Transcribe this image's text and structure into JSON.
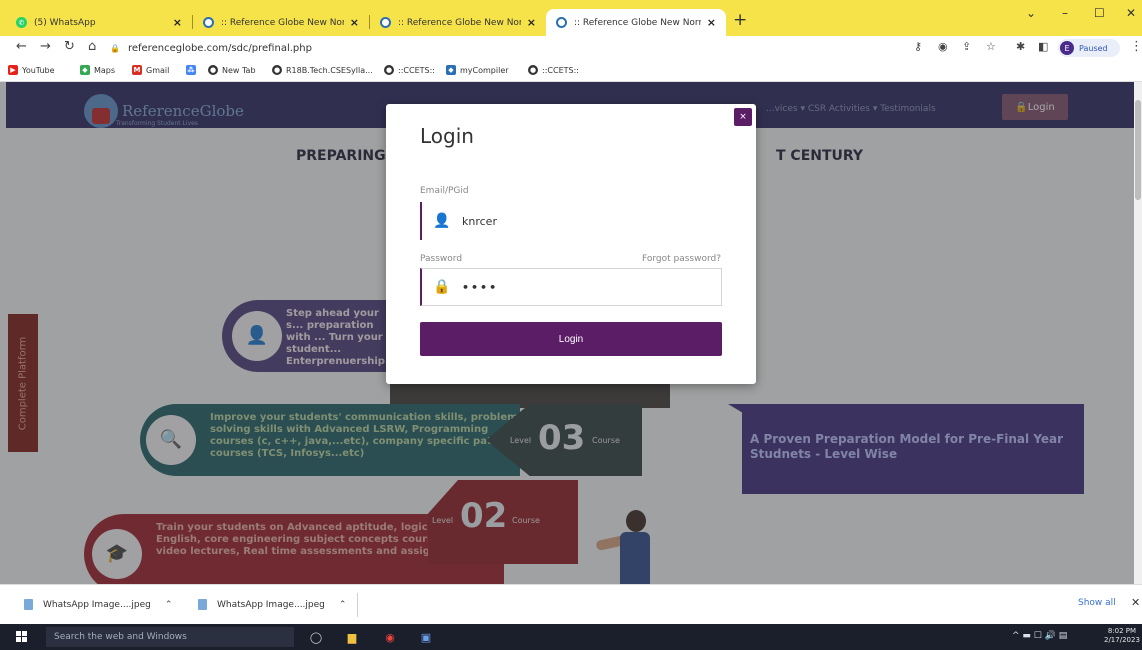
{
  "browser": {
    "tabs": [
      {
        "title": "(5) WhatsApp",
        "favicon": "whatsapp-icon",
        "active": false
      },
      {
        "title": ":: Reference Globe New Normal ::",
        "favicon": "referenceglobe-icon",
        "active": false
      },
      {
        "title": ":: Reference Globe New Normal ::",
        "favicon": "referenceglobe-icon",
        "active": false
      },
      {
        "title": ":: Reference Globe New Normal ::",
        "favicon": "referenceglobe-icon",
        "active": true
      }
    ],
    "new_tab": "+",
    "url": "referenceglobe.com/sdc/prefinal.php",
    "profile_initial": "E",
    "profile_status": "Paused",
    "bookmarks": [
      {
        "label": "YouTube",
        "color": "#e62117"
      },
      {
        "label": "Maps",
        "color": "#34a853"
      },
      {
        "label": "Gmail",
        "color": "#d93025"
      },
      {
        "label": "",
        "color": "#4285f4"
      },
      {
        "label": "New Tab",
        "color": "#333333"
      },
      {
        "label": "R18B.Tech.CSESylla...",
        "color": "#333333"
      },
      {
        "label": "::CCETS::",
        "color": "#333333"
      },
      {
        "label": "myCompiler",
        "color": "#2a6fb5"
      },
      {
        "label": "::CCETS::",
        "color": "#333333"
      }
    ]
  },
  "site": {
    "brand_name": "ReferenceGlobe",
    "brand_tagline": "Transforming Student Lives",
    "nav_links": "...vices ▾    CSR Activities ▾    Testimonials",
    "nav_login": "🔒Login",
    "headline_left": "PREPARING",
    "headline_right": "T CENTURY",
    "side_tab": "Complete Platform",
    "steps": [
      {
        "text": "Step ahead your s... preparation with ... Turn your student... Enterprenuership...",
        "icon": "user-search-icon"
      },
      {
        "text": "Improve your students' communication skills, problem solving skills with Advanced LSRW, Programming courses (c, c++, java,...etc), company specific pattern courses (TCS, Infosys...etc)",
        "icon": "zoom-icon"
      },
      {
        "text": "Train your students on Advanced aptitude, logical reasoning, English, core engineering subject concepts courses with video lectures, Real time assessments and assignments",
        "icon": "student-icon"
      }
    ],
    "level3": {
      "prefix": "Level",
      "number": "03",
      "suffix": "Course"
    },
    "level2": {
      "prefix": "Level",
      "number": "02",
      "suffix": "Course"
    },
    "proven_text": "A Proven Preparation Model for Pre-Final Year Studnets - Level Wise"
  },
  "login_modal": {
    "title": "Login",
    "close": "×",
    "email_label": "Email/PGid",
    "email_value": "knrcer",
    "password_label": "Password",
    "forgot_password": "Forgot password?",
    "password_value": "••••",
    "submit_label": "Login"
  },
  "downloads": {
    "items": [
      {
        "name": "WhatsApp Image....jpeg"
      },
      {
        "name": "WhatsApp Image....jpeg"
      }
    ],
    "show_all": "Show all"
  },
  "taskbar": {
    "search_placeholder": "Search the web and Windows",
    "time": "8:02 PM",
    "date": "2/17/2023"
  }
}
